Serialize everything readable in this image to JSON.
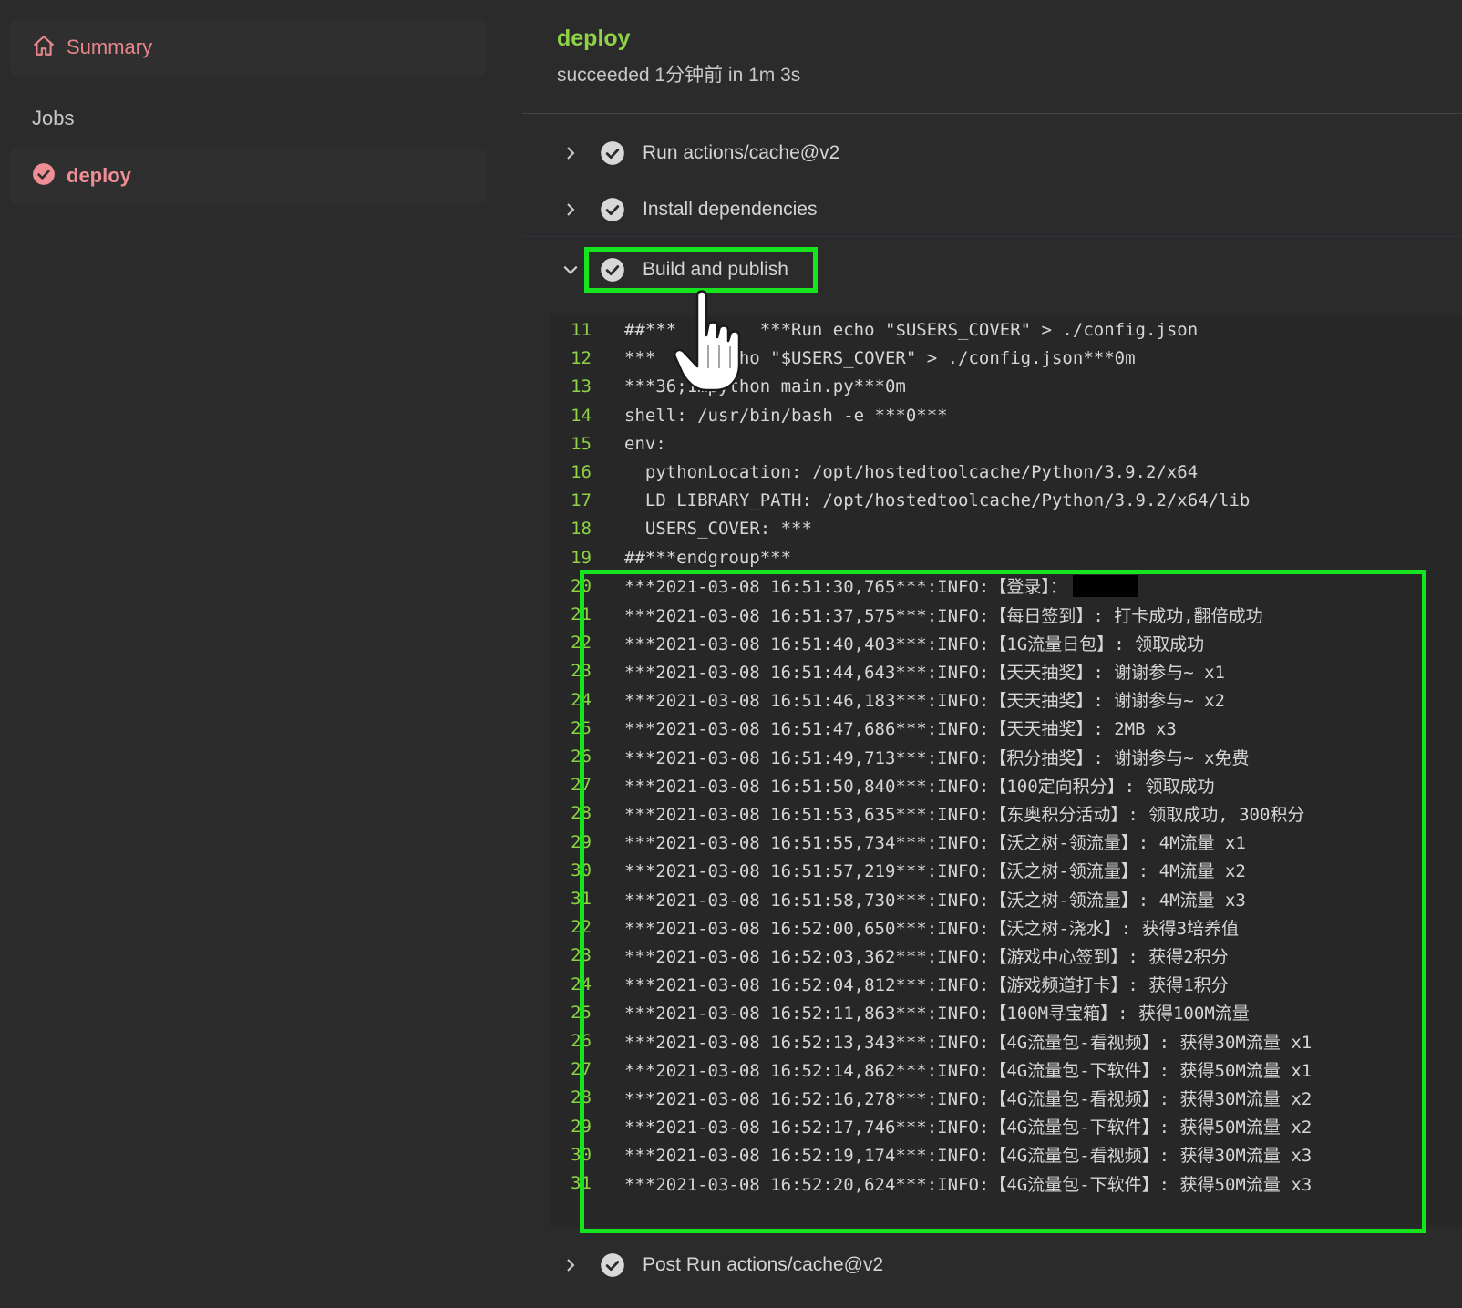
{
  "sidebar": {
    "summary_label": "Summary",
    "jobs_heading": "Jobs",
    "job_label": "deploy"
  },
  "job": {
    "title": "deploy",
    "status": "succeeded 1分钟前 in 1m 3s"
  },
  "steps": [
    {
      "label": "Run actions/cache@v2",
      "expanded": false
    },
    {
      "label": "Install dependencies",
      "expanded": false
    },
    {
      "label": "Build and publish",
      "expanded": true
    },
    {
      "label": "Post Run actions/cache@v2",
      "expanded": false
    }
  ],
  "log_lines": [
    {
      "num": "11",
      "text": "##***        ***Run echo \"$USERS_COVER\" > ./config.json"
    },
    {
      "num": "12",
      "text": "\u001b***      echo \"$USERS_COVER\" > ./config.json\u001b***0m"
    },
    {
      "num": "13",
      "text": "\u001b***36;1mpython main.py\u001b***0m"
    },
    {
      "num": "14",
      "text": "shell: /usr/bin/bash -e ***0***"
    },
    {
      "num": "15",
      "text": "env:"
    },
    {
      "num": "16",
      "text": "  pythonLocation: /opt/hostedtoolcache/Python/3.9.2/x64"
    },
    {
      "num": "17",
      "text": "  LD_LIBRARY_PATH: /opt/hostedtoolcache/Python/3.9.2/x64/lib"
    },
    {
      "num": "18",
      "text": "  USERS_COVER: ***"
    },
    {
      "num": "19",
      "text": "##***endgroup***"
    },
    {
      "num": "20",
      "text": "***2021-03-08 16:51:30,765***:INFO:【登录】："
    },
    {
      "num": "21",
      "text": "***2021-03-08 16:51:37,575***:INFO:【每日签到】: 打卡成功,翻倍成功"
    },
    {
      "num": "22",
      "text": "***2021-03-08 16:51:40,403***:INFO:【1G流量日包】: 领取成功"
    },
    {
      "num": "23",
      "text": "***2021-03-08 16:51:44,643***:INFO:【天天抽奖】: 谢谢参与~ x1"
    },
    {
      "num": "24",
      "text": "***2021-03-08 16:51:46,183***:INFO:【天天抽奖】: 谢谢参与~ x2"
    },
    {
      "num": "25",
      "text": "***2021-03-08 16:51:47,686***:INFO:【天天抽奖】: 2MB x3"
    },
    {
      "num": "26",
      "text": "***2021-03-08 16:51:49,713***:INFO:【积分抽奖】: 谢谢参与~ x免费"
    },
    {
      "num": "27",
      "text": "***2021-03-08 16:51:50,840***:INFO:【100定向积分】: 领取成功"
    },
    {
      "num": "28",
      "text": "***2021-03-08 16:51:53,635***:INFO:【东奥积分活动】: 领取成功, 300积分"
    },
    {
      "num": "29",
      "text": "***2021-03-08 16:51:55,734***:INFO:【沃之树-领流量】: 4M流量 x1"
    },
    {
      "num": "30",
      "text": "***2021-03-08 16:51:57,219***:INFO:【沃之树-领流量】: 4M流量 x2"
    },
    {
      "num": "31",
      "text": "***2021-03-08 16:51:58,730***:INFO:【沃之树-领流量】: 4M流量 x3"
    },
    {
      "num": "22",
      "text": "***2021-03-08 16:52:00,650***:INFO:【沃之树-浇水】: 获得3培养值"
    },
    {
      "num": "23",
      "text": "***2021-03-08 16:52:03,362***:INFO:【游戏中心签到】: 获得2积分"
    },
    {
      "num": "24",
      "text": "***2021-03-08 16:52:04,812***:INFO:【游戏频道打卡】: 获得1积分"
    },
    {
      "num": "25",
      "text": "***2021-03-08 16:52:11,863***:INFO:【100M寻宝箱】: 获得100M流量"
    },
    {
      "num": "26",
      "text": "***2021-03-08 16:52:13,343***:INFO:【4G流量包-看视频】: 获得30M流量 x1"
    },
    {
      "num": "27",
      "text": "***2021-03-08 16:52:14,862***:INFO:【4G流量包-下软件】: 获得50M流量 x1"
    },
    {
      "num": "28",
      "text": "***2021-03-08 16:52:16,278***:INFO:【4G流量包-看视频】: 获得30M流量 x2"
    },
    {
      "num": "29",
      "text": "***2021-03-08 16:52:17,746***:INFO:【4G流量包-下软件】: 获得50M流量 x2"
    },
    {
      "num": "30",
      "text": "***2021-03-08 16:52:19,174***:INFO:【4G流量包-看视频】: 获得30M流量 x3"
    },
    {
      "num": "31",
      "text": "***2021-03-08 16:52:20,624***:INFO:【4G流量包-下软件】: 获得50M流量 x3"
    }
  ],
  "colors": {
    "accent_green": "#8ed246",
    "highlight_green": "#16e41e",
    "link_red": "#e5878a",
    "success_check": "#d8d8d8"
  }
}
